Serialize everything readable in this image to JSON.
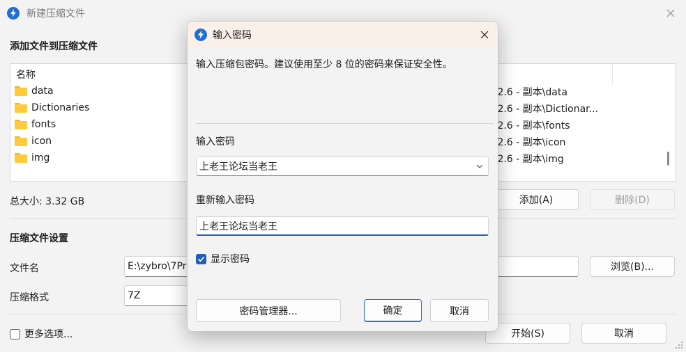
{
  "main_window": {
    "title": "新建压缩文件",
    "add_section_heading": "添加文件到压缩文件",
    "file_list": {
      "column_header": "名称",
      "items": [
        {
          "name": "data",
          "path": ".2.6 - 副本\\data"
        },
        {
          "name": "Dictionaries",
          "path": ".2.6 - 副本\\Dictionar..."
        },
        {
          "name": "fonts",
          "path": ".2.6 - 副本\\fonts"
        },
        {
          "name": "icon",
          "path": ".2.6 - 副本\\icon"
        },
        {
          "name": "img",
          "path": ".2.6 - 副本\\img"
        }
      ]
    },
    "total_size": "总大小: 3.32 GB",
    "add_button": "添加(A)",
    "delete_button": "删除(D)",
    "settings_heading": "压缩文件设置",
    "filename_label": "文件名",
    "filename_value": "E:\\zybro\\7Pr",
    "browse_button": "浏览(B)...",
    "format_label": "压缩格式",
    "format_value": "7Z",
    "more_options_label": "更多选项...",
    "start_button": "开始(S)",
    "cancel_button": "取消"
  },
  "dialog": {
    "title": "输入密码",
    "description": "输入压缩包密码。建议使用至少 8 位的密码来保证安全性。",
    "password_label": "输入密码",
    "password_value": "上老王论坛当老王",
    "reenter_label": "重新输入密码",
    "reenter_value": "上老王论坛当老王",
    "show_password_label": "显示密码",
    "show_password_checked": true,
    "password_manager_button": "密码管理器...",
    "ok_button": "确定",
    "cancel_button": "取消"
  },
  "colors": {
    "accent": "#1f5fb8",
    "folder": "#ffcb3d",
    "dialog_titlebar": "#fbf0e8"
  }
}
